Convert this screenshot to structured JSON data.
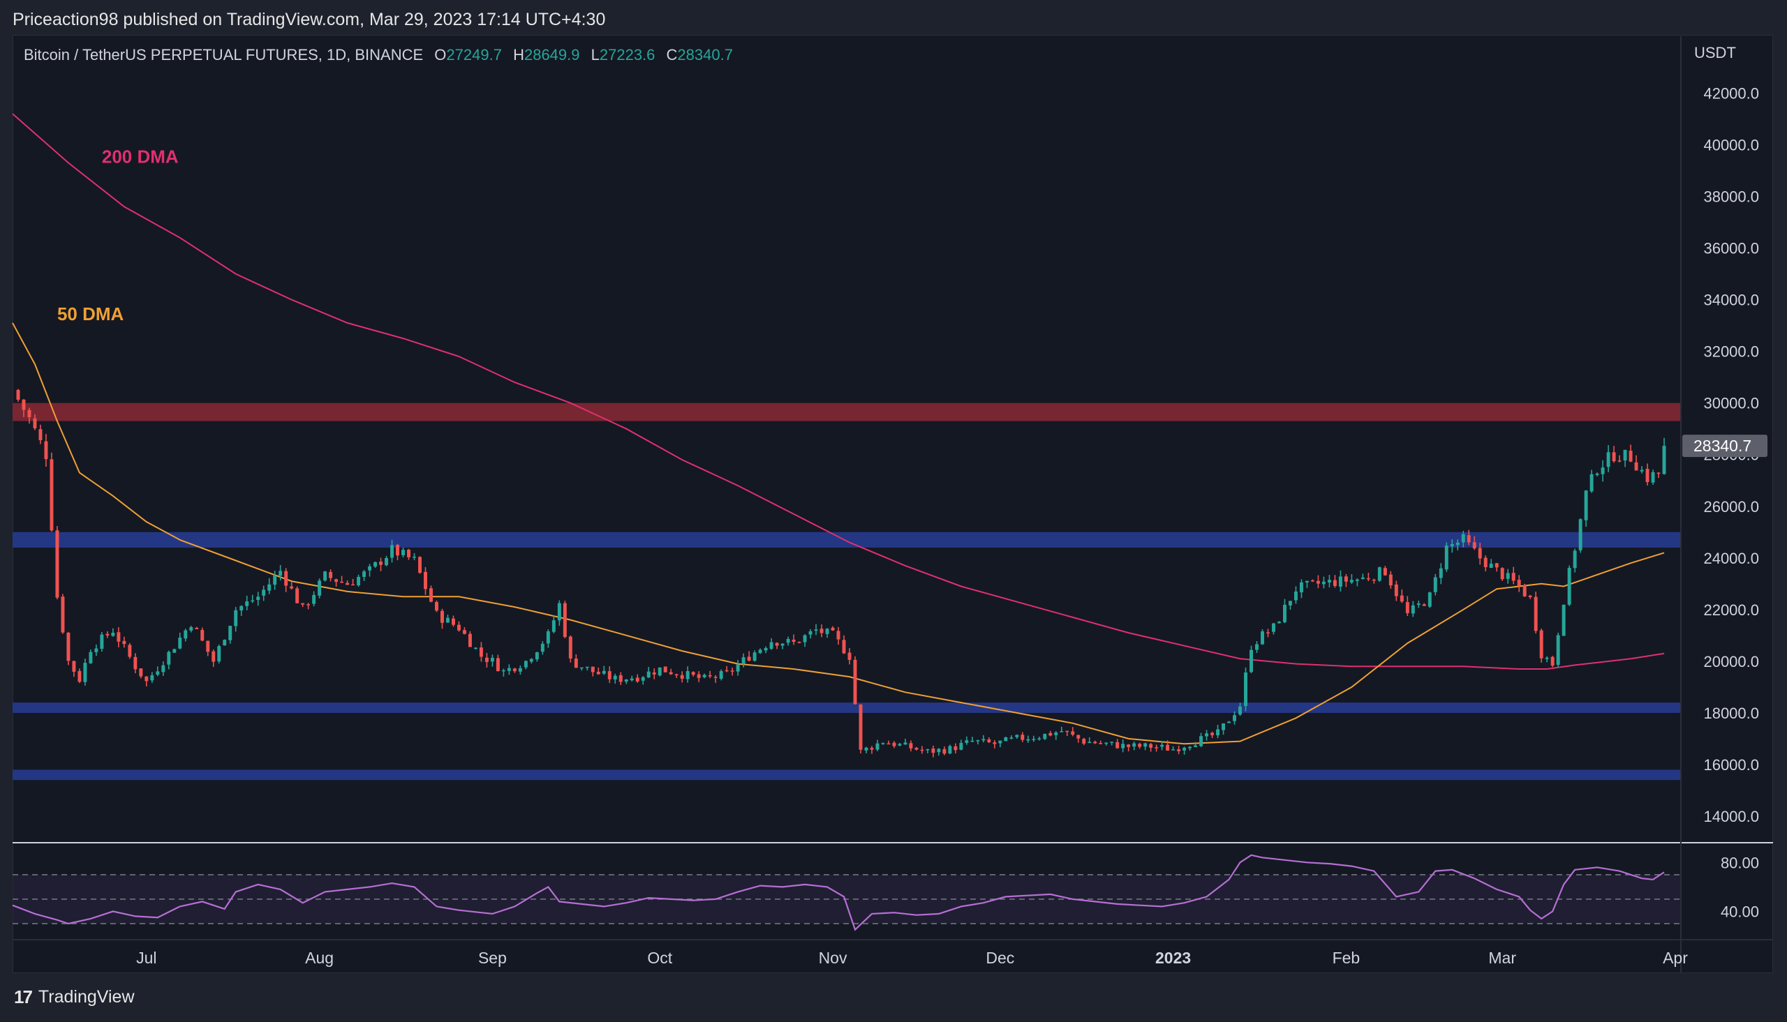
{
  "header": {
    "published_line": "Priceaction98 published on TradingView.com, Mar 29, 2023 17:14 UTC+4:30"
  },
  "legend": {
    "symbol": "Bitcoin / TetherUS PERPETUAL FUTURES, 1D, BINANCE",
    "open_label": "O",
    "open": "27249.7",
    "high_label": "H",
    "high": "28649.9",
    "low_label": "L",
    "low": "27223.6",
    "close_label": "C",
    "close": "28340.7"
  },
  "footer": {
    "logo": "17",
    "brand": "TradingView"
  },
  "colors": {
    "up": "#26a69a",
    "down": "#ef5350",
    "dma50": "#f0a033",
    "dma200": "#e0306f",
    "resistance_zone": "#7d2733",
    "support_zone": "#25398a",
    "rsi": "#b66fd4"
  },
  "chart_data": [
    {
      "type": "candlestick",
      "title": "",
      "currency_label": "USDT",
      "y_ticks": [
        "42000.0",
        "40000.0",
        "38000.0",
        "36000.0",
        "34000.0",
        "32000.0",
        "30000.0",
        "28000.0",
        "26000.0",
        "24000.0",
        "22000.0",
        "20000.0",
        "18000.0",
        "16000.0",
        "14000.0"
      ],
      "ylim": [
        13000,
        44200
      ],
      "x_ticks": [
        {
          "label": "Jul",
          "t": 14
        },
        {
          "label": "Aug",
          "t": 45
        },
        {
          "label": "Sep",
          "t": 76
        },
        {
          "label": "Oct",
          "t": 106
        },
        {
          "label": "Nov",
          "t": 137
        },
        {
          "label": "Dec",
          "t": 167
        },
        {
          "label": "2023",
          "t": 198
        },
        {
          "label": "Feb",
          "t": 229
        },
        {
          "label": "Mar",
          "t": 257
        },
        {
          "label": "Apr",
          "t": 288
        }
      ],
      "xlim": [
        -10,
        289
      ],
      "last_price": "28340.7",
      "price_path": [
        [
          -10,
          30500
        ],
        [
          -7,
          29400
        ],
        [
          -4,
          28000
        ],
        [
          -2,
          22500
        ],
        [
          0,
          20000
        ],
        [
          2,
          19300
        ],
        [
          4,
          20500
        ],
        [
          8,
          21200
        ],
        [
          12,
          19800
        ],
        [
          14,
          19200
        ],
        [
          18,
          20300
        ],
        [
          22,
          21500
        ],
        [
          26,
          20000
        ],
        [
          30,
          22000
        ],
        [
          34,
          22500
        ],
        [
          38,
          23500
        ],
        [
          42,
          22000
        ],
        [
          46,
          23300
        ],
        [
          50,
          23000
        ],
        [
          54,
          23500
        ],
        [
          58,
          24300
        ],
        [
          62,
          23900
        ],
        [
          66,
          21800
        ],
        [
          70,
          21300
        ],
        [
          74,
          20200
        ],
        [
          76,
          20000
        ],
        [
          78,
          19600
        ],
        [
          82,
          20000
        ],
        [
          86,
          21000
        ],
        [
          88,
          22200
        ],
        [
          90,
          20000
        ],
        [
          94,
          19600
        ],
        [
          98,
          19300
        ],
        [
          102,
          19400
        ],
        [
          106,
          19700
        ],
        [
          110,
          19500
        ],
        [
          114,
          19300
        ],
        [
          118,
          19500
        ],
        [
          122,
          20200
        ],
        [
          126,
          20800
        ],
        [
          130,
          20700
        ],
        [
          134,
          21200
        ],
        [
          137,
          21000
        ],
        [
          140,
          20200
        ],
        [
          142,
          16500
        ],
        [
          146,
          16900
        ],
        [
          150,
          16700
        ],
        [
          154,
          16500
        ],
        [
          158,
          16600
        ],
        [
          162,
          16900
        ],
        [
          166,
          16800
        ],
        [
          170,
          17000
        ],
        [
          174,
          17100
        ],
        [
          178,
          17300
        ],
        [
          182,
          16900
        ],
        [
          186,
          16800
        ],
        [
          190,
          16700
        ],
        [
          194,
          16700
        ],
        [
          198,
          16600
        ],
        [
          202,
          16900
        ],
        [
          206,
          17200
        ],
        [
          210,
          18300
        ],
        [
          212,
          20600
        ],
        [
          214,
          21000
        ],
        [
          216,
          21300
        ],
        [
          220,
          22800
        ],
        [
          224,
          23000
        ],
        [
          228,
          23100
        ],
        [
          232,
          23200
        ],
        [
          236,
          23500
        ],
        [
          240,
          21800
        ],
        [
          244,
          22500
        ],
        [
          247,
          24400
        ],
        [
          250,
          24700
        ],
        [
          253,
          24000
        ],
        [
          256,
          23500
        ],
        [
          258,
          23200
        ],
        [
          260,
          22900
        ],
        [
          262,
          22400
        ],
        [
          264,
          20300
        ],
        [
          266,
          19900
        ],
        [
          268,
          22400
        ],
        [
          270,
          24400
        ],
        [
          272,
          26500
        ],
        [
          274,
          27500
        ],
        [
          277,
          28000
        ],
        [
          280,
          27900
        ],
        [
          283,
          27100
        ],
        [
          285,
          27300
        ],
        [
          286,
          28340
        ]
      ],
      "series": [
        {
          "name": "200 DMA",
          "points": [
            [
              -10,
              41200
            ],
            [
              0,
              39300
            ],
            [
              10,
              37600
            ],
            [
              20,
              36400
            ],
            [
              30,
              35000
            ],
            [
              40,
              34000
            ],
            [
              50,
              33100
            ],
            [
              60,
              32500
            ],
            [
              70,
              31800
            ],
            [
              80,
              30800
            ],
            [
              90,
              30000
            ],
            [
              100,
              29000
            ],
            [
              110,
              27800
            ],
            [
              120,
              26800
            ],
            [
              130,
              25700
            ],
            [
              140,
              24600
            ],
            [
              150,
              23700
            ],
            [
              160,
              22900
            ],
            [
              170,
              22300
            ],
            [
              180,
              21700
            ],
            [
              190,
              21100
            ],
            [
              200,
              20600
            ],
            [
              210,
              20100
            ],
            [
              220,
              19900
            ],
            [
              230,
              19800
            ],
            [
              240,
              19800
            ],
            [
              250,
              19800
            ],
            [
              260,
              19700
            ],
            [
              265,
              19700
            ],
            [
              270,
              19850
            ],
            [
              280,
              20100
            ],
            [
              286,
              20300
            ]
          ]
        },
        {
          "name": "50 DMA",
          "points": [
            [
              -10,
              33100
            ],
            [
              -6,
              31500
            ],
            [
              -2,
              29300
            ],
            [
              2,
              27300
            ],
            [
              8,
              26400
            ],
            [
              14,
              25400
            ],
            [
              20,
              24700
            ],
            [
              30,
              23900
            ],
            [
              40,
              23100
            ],
            [
              50,
              22700
            ],
            [
              60,
              22500
            ],
            [
              70,
              22500
            ],
            [
              80,
              22100
            ],
            [
              90,
              21600
            ],
            [
              100,
              21000
            ],
            [
              110,
              20400
            ],
            [
              120,
              19900
            ],
            [
              130,
              19700
            ],
            [
              140,
              19400
            ],
            [
              150,
              18800
            ],
            [
              160,
              18400
            ],
            [
              170,
              18000
            ],
            [
              180,
              17600
            ],
            [
              190,
              17000
            ],
            [
              200,
              16800
            ],
            [
              210,
              16900
            ],
            [
              220,
              17800
            ],
            [
              230,
              19000
            ],
            [
              240,
              20700
            ],
            [
              250,
              22000
            ],
            [
              256,
              22800
            ],
            [
              260,
              22900
            ],
            [
              264,
              23000
            ],
            [
              268,
              22900
            ],
            [
              272,
              23200
            ],
            [
              280,
              23800
            ],
            [
              286,
              24200
            ]
          ]
        }
      ],
      "zones": [
        {
          "name": "resistance",
          "low": 29300,
          "high": 30000
        },
        {
          "name": "support-1",
          "low": 24400,
          "high": 25000
        },
        {
          "name": "support-2",
          "low": 18000,
          "high": 18400
        },
        {
          "name": "support-3",
          "low": 15400,
          "high": 15800
        }
      ],
      "annotations": [
        {
          "text": "200 DMA",
          "x": 6,
          "y": 39300
        },
        {
          "text": "50 DMA",
          "x": -2,
          "y": 33200
        }
      ]
    },
    {
      "type": "line",
      "title": "",
      "y_ticks": [
        "80.00",
        "40.00"
      ],
      "ylim": [
        18,
        95
      ],
      "bands": [
        70,
        50,
        30
      ],
      "series": [
        {
          "points": [
            [
              -10,
              45
            ],
            [
              -6,
              38
            ],
            [
              -2,
              33
            ],
            [
              0,
              30
            ],
            [
              4,
              34
            ],
            [
              8,
              40
            ],
            [
              12,
              36
            ],
            [
              16,
              35
            ],
            [
              20,
              44
            ],
            [
              24,
              48
            ],
            [
              28,
              42
            ],
            [
              30,
              56
            ],
            [
              34,
              62
            ],
            [
              38,
              58
            ],
            [
              42,
              47
            ],
            [
              46,
              56
            ],
            [
              50,
              58
            ],
            [
              54,
              60
            ],
            [
              58,
              63
            ],
            [
              62,
              60
            ],
            [
              66,
              44
            ],
            [
              70,
              41
            ],
            [
              74,
              39
            ],
            [
              76,
              38
            ],
            [
              80,
              44
            ],
            [
              84,
              55
            ],
            [
              86,
              60
            ],
            [
              88,
              48
            ],
            [
              92,
              46
            ],
            [
              96,
              44
            ],
            [
              100,
              47
            ],
            [
              104,
              51
            ],
            [
              108,
              50
            ],
            [
              112,
              49
            ],
            [
              116,
              50
            ],
            [
              120,
              56
            ],
            [
              124,
              61
            ],
            [
              128,
              60
            ],
            [
              132,
              62
            ],
            [
              136,
              60
            ],
            [
              139,
              52
            ],
            [
              141,
              25
            ],
            [
              144,
              38
            ],
            [
              148,
              39
            ],
            [
              152,
              37
            ],
            [
              156,
              38
            ],
            [
              160,
              44
            ],
            [
              164,
              47
            ],
            [
              168,
              52
            ],
            [
              172,
              53
            ],
            [
              176,
              54
            ],
            [
              180,
              50
            ],
            [
              184,
              48
            ],
            [
              188,
              46
            ],
            [
              192,
              45
            ],
            [
              196,
              44
            ],
            [
              200,
              47
            ],
            [
              204,
              52
            ],
            [
              208,
              66
            ],
            [
              210,
              80
            ],
            [
              212,
              86
            ],
            [
              214,
              84
            ],
            [
              218,
              82
            ],
            [
              222,
              80
            ],
            [
              226,
              79
            ],
            [
              230,
              77
            ],
            [
              234,
              73
            ],
            [
              238,
              52
            ],
            [
              242,
              56
            ],
            [
              245,
              73
            ],
            [
              248,
              74
            ],
            [
              252,
              67
            ],
            [
              256,
              58
            ],
            [
              258,
              55
            ],
            [
              260,
              52
            ],
            [
              262,
              41
            ],
            [
              264,
              34
            ],
            [
              266,
              40
            ],
            [
              268,
              62
            ],
            [
              270,
              74
            ],
            [
              274,
              76
            ],
            [
              278,
              73
            ],
            [
              282,
              67
            ],
            [
              284,
              66
            ],
            [
              286,
              72
            ]
          ]
        }
      ]
    }
  ]
}
